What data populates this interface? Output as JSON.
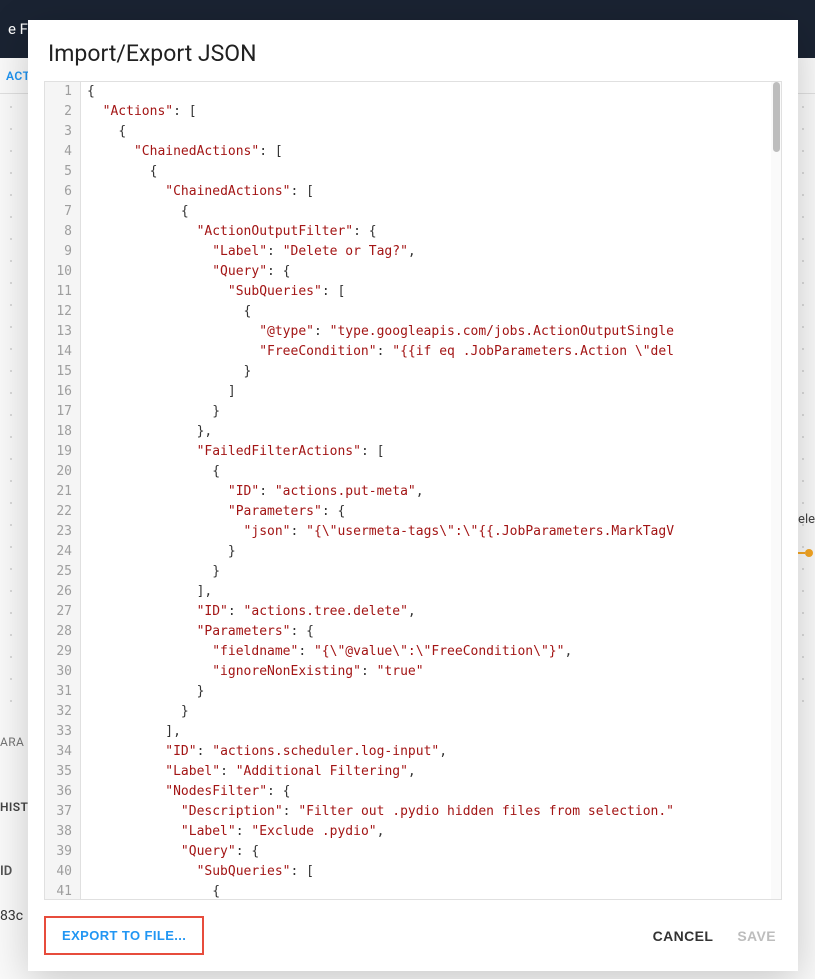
{
  "dialog": {
    "title": "Import/Export JSON",
    "buttons": {
      "export": "EXPORT TO FILE...",
      "cancel": "CANCEL",
      "save": "SAVE"
    }
  },
  "backdrop": {
    "header_fragment": "e F",
    "tab_fragment": "ACTI",
    "section_separa": "ara",
    "section_hist": "HIST",
    "id_label": "ID",
    "id_val_fragment": "83c",
    "right_label": "Dele",
    "right_arrow_glyph": "➔"
  },
  "code_lines": [
    {
      "n": 1,
      "indent": 0,
      "parts": [
        {
          "t": "punc",
          "v": "{"
        }
      ]
    },
    {
      "n": 2,
      "indent": 1,
      "parts": [
        {
          "t": "key",
          "v": "\"Actions\""
        },
        {
          "t": "punc",
          "v": ": ["
        }
      ]
    },
    {
      "n": 3,
      "indent": 2,
      "parts": [
        {
          "t": "punc",
          "v": "{"
        }
      ]
    },
    {
      "n": 4,
      "indent": 3,
      "parts": [
        {
          "t": "key",
          "v": "\"ChainedActions\""
        },
        {
          "t": "punc",
          "v": ": ["
        }
      ]
    },
    {
      "n": 5,
      "indent": 4,
      "parts": [
        {
          "t": "punc",
          "v": "{"
        }
      ]
    },
    {
      "n": 6,
      "indent": 5,
      "parts": [
        {
          "t": "key",
          "v": "\"ChainedActions\""
        },
        {
          "t": "punc",
          "v": ": ["
        }
      ]
    },
    {
      "n": 7,
      "indent": 6,
      "parts": [
        {
          "t": "punc",
          "v": "{"
        }
      ]
    },
    {
      "n": 8,
      "indent": 7,
      "parts": [
        {
          "t": "key",
          "v": "\"ActionOutputFilter\""
        },
        {
          "t": "punc",
          "v": ": {"
        }
      ]
    },
    {
      "n": 9,
      "indent": 8,
      "parts": [
        {
          "t": "key",
          "v": "\"Label\""
        },
        {
          "t": "punc",
          "v": ": "
        },
        {
          "t": "str",
          "v": "\"Delete or Tag?\""
        },
        {
          "t": "punc",
          "v": ","
        }
      ]
    },
    {
      "n": 10,
      "indent": 8,
      "parts": [
        {
          "t": "key",
          "v": "\"Query\""
        },
        {
          "t": "punc",
          "v": ": {"
        }
      ]
    },
    {
      "n": 11,
      "indent": 9,
      "parts": [
        {
          "t": "key",
          "v": "\"SubQueries\""
        },
        {
          "t": "punc",
          "v": ": ["
        }
      ]
    },
    {
      "n": 12,
      "indent": 10,
      "parts": [
        {
          "t": "punc",
          "v": "{"
        }
      ]
    },
    {
      "n": 13,
      "indent": 11,
      "parts": [
        {
          "t": "key",
          "v": "\"@type\""
        },
        {
          "t": "punc",
          "v": ": "
        },
        {
          "t": "str",
          "v": "\"type.googleapis.com/jobs.ActionOutputSingle"
        }
      ]
    },
    {
      "n": 14,
      "indent": 11,
      "parts": [
        {
          "t": "key",
          "v": "\"FreeCondition\""
        },
        {
          "t": "punc",
          "v": ": "
        },
        {
          "t": "str",
          "v": "\"{{if eq .JobParameters.Action \\\"del"
        }
      ]
    },
    {
      "n": 15,
      "indent": 10,
      "parts": [
        {
          "t": "punc",
          "v": "}"
        }
      ]
    },
    {
      "n": 16,
      "indent": 9,
      "parts": [
        {
          "t": "punc",
          "v": "]"
        }
      ]
    },
    {
      "n": 17,
      "indent": 8,
      "parts": [
        {
          "t": "punc",
          "v": "}"
        }
      ]
    },
    {
      "n": 18,
      "indent": 7,
      "parts": [
        {
          "t": "punc",
          "v": "},"
        }
      ]
    },
    {
      "n": 19,
      "indent": 7,
      "parts": [
        {
          "t": "key",
          "v": "\"FailedFilterActions\""
        },
        {
          "t": "punc",
          "v": ": ["
        }
      ]
    },
    {
      "n": 20,
      "indent": 8,
      "parts": [
        {
          "t": "punc",
          "v": "{"
        }
      ]
    },
    {
      "n": 21,
      "indent": 9,
      "parts": [
        {
          "t": "key",
          "v": "\"ID\""
        },
        {
          "t": "punc",
          "v": ": "
        },
        {
          "t": "str",
          "v": "\"actions.put-meta\""
        },
        {
          "t": "punc",
          "v": ","
        }
      ]
    },
    {
      "n": 22,
      "indent": 9,
      "parts": [
        {
          "t": "key",
          "v": "\"Parameters\""
        },
        {
          "t": "punc",
          "v": ": {"
        }
      ]
    },
    {
      "n": 23,
      "indent": 10,
      "parts": [
        {
          "t": "key",
          "v": "\"json\""
        },
        {
          "t": "punc",
          "v": ": "
        },
        {
          "t": "str",
          "v": "\"{\\\"usermeta-tags\\\":\\\"{{.JobParameters.MarkTagV"
        }
      ]
    },
    {
      "n": 24,
      "indent": 9,
      "parts": [
        {
          "t": "punc",
          "v": "}"
        }
      ]
    },
    {
      "n": 25,
      "indent": 8,
      "parts": [
        {
          "t": "punc",
          "v": "}"
        }
      ]
    },
    {
      "n": 26,
      "indent": 7,
      "parts": [
        {
          "t": "punc",
          "v": "],"
        }
      ]
    },
    {
      "n": 27,
      "indent": 7,
      "parts": [
        {
          "t": "key",
          "v": "\"ID\""
        },
        {
          "t": "punc",
          "v": ": "
        },
        {
          "t": "str",
          "v": "\"actions.tree.delete\""
        },
        {
          "t": "punc",
          "v": ","
        }
      ]
    },
    {
      "n": 28,
      "indent": 7,
      "parts": [
        {
          "t": "key",
          "v": "\"Parameters\""
        },
        {
          "t": "punc",
          "v": ": {"
        }
      ]
    },
    {
      "n": 29,
      "indent": 8,
      "parts": [
        {
          "t": "key",
          "v": "\"fieldname\""
        },
        {
          "t": "punc",
          "v": ": "
        },
        {
          "t": "str",
          "v": "\"{\\\"@value\\\":\\\"FreeCondition\\\"}\""
        },
        {
          "t": "punc",
          "v": ","
        }
      ]
    },
    {
      "n": 30,
      "indent": 8,
      "parts": [
        {
          "t": "key",
          "v": "\"ignoreNonExisting\""
        },
        {
          "t": "punc",
          "v": ": "
        },
        {
          "t": "str",
          "v": "\"true\""
        }
      ]
    },
    {
      "n": 31,
      "indent": 7,
      "parts": [
        {
          "t": "punc",
          "v": "}"
        }
      ]
    },
    {
      "n": 32,
      "indent": 6,
      "parts": [
        {
          "t": "punc",
          "v": "}"
        }
      ]
    },
    {
      "n": 33,
      "indent": 5,
      "parts": [
        {
          "t": "punc",
          "v": "],"
        }
      ]
    },
    {
      "n": 34,
      "indent": 5,
      "parts": [
        {
          "t": "key",
          "v": "\"ID\""
        },
        {
          "t": "punc",
          "v": ": "
        },
        {
          "t": "str",
          "v": "\"actions.scheduler.log-input\""
        },
        {
          "t": "punc",
          "v": ","
        }
      ]
    },
    {
      "n": 35,
      "indent": 5,
      "parts": [
        {
          "t": "key",
          "v": "\"Label\""
        },
        {
          "t": "punc",
          "v": ": "
        },
        {
          "t": "str",
          "v": "\"Additional Filtering\""
        },
        {
          "t": "punc",
          "v": ","
        }
      ]
    },
    {
      "n": 36,
      "indent": 5,
      "parts": [
        {
          "t": "key",
          "v": "\"NodesFilter\""
        },
        {
          "t": "punc",
          "v": ": {"
        }
      ]
    },
    {
      "n": 37,
      "indent": 6,
      "parts": [
        {
          "t": "key",
          "v": "\"Description\""
        },
        {
          "t": "punc",
          "v": ": "
        },
        {
          "t": "str",
          "v": "\"Filter out .pydio hidden files from selection.\""
        }
      ]
    },
    {
      "n": 38,
      "indent": 6,
      "parts": [
        {
          "t": "key",
          "v": "\"Label\""
        },
        {
          "t": "punc",
          "v": ": "
        },
        {
          "t": "str",
          "v": "\"Exclude .pydio\""
        },
        {
          "t": "punc",
          "v": ","
        }
      ]
    },
    {
      "n": 39,
      "indent": 6,
      "parts": [
        {
          "t": "key",
          "v": "\"Query\""
        },
        {
          "t": "punc",
          "v": ": {"
        }
      ]
    },
    {
      "n": 40,
      "indent": 7,
      "parts": [
        {
          "t": "key",
          "v": "\"SubQueries\""
        },
        {
          "t": "punc",
          "v": ": ["
        }
      ]
    },
    {
      "n": 41,
      "indent": 8,
      "parts": [
        {
          "t": "punc",
          "v": "{"
        }
      ]
    }
  ]
}
